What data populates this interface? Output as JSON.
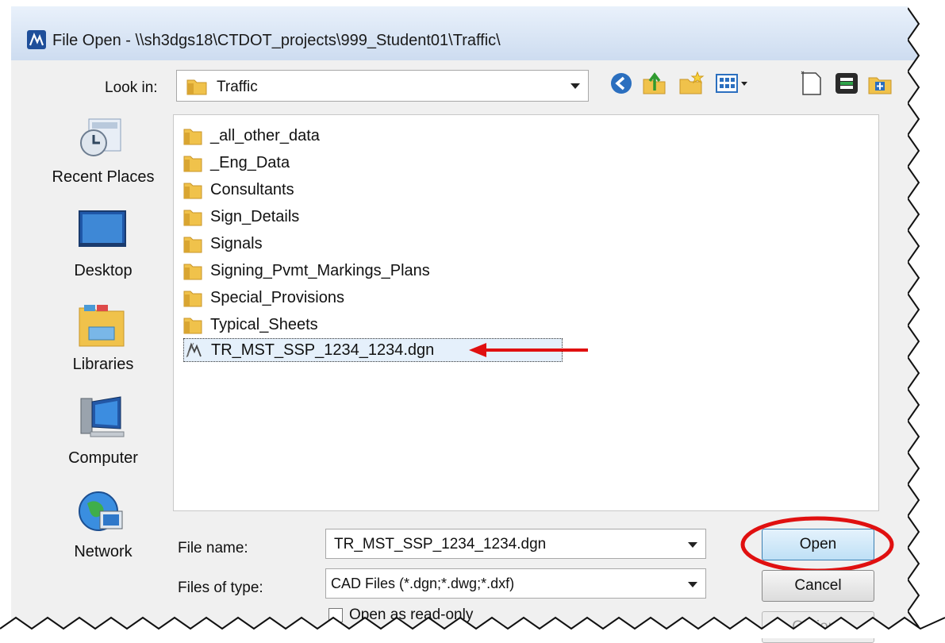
{
  "window": {
    "title": "File Open - \\\\sh3dgs18\\CTDOT_projects\\999_Student01\\Traffic\\"
  },
  "lookin": {
    "label": "Look in:",
    "value": "Traffic"
  },
  "toolbar": {
    "icons": [
      "back-icon",
      "up-folder-icon",
      "new-folder-icon",
      "view-menu-icon",
      "new-file-icon",
      "bentley-icon",
      "workset-icon"
    ]
  },
  "places": [
    {
      "label": "Recent Places",
      "icon": "recent-places-icon"
    },
    {
      "label": "Desktop",
      "icon": "desktop-icon"
    },
    {
      "label": "Libraries",
      "icon": "libraries-icon"
    },
    {
      "label": "Computer",
      "icon": "computer-icon"
    },
    {
      "label": "Network",
      "icon": "network-icon"
    }
  ],
  "files": [
    {
      "name": "_all_other_data",
      "type": "folder"
    },
    {
      "name": "_Eng_Data",
      "type": "folder"
    },
    {
      "name": "Consultants",
      "type": "folder"
    },
    {
      "name": "Sign_Details",
      "type": "folder"
    },
    {
      "name": "Signals",
      "type": "folder"
    },
    {
      "name": "Signing_Pvmt_Markings_Plans",
      "type": "folder"
    },
    {
      "name": "Special_Provisions",
      "type": "folder"
    },
    {
      "name": "Typical_Sheets",
      "type": "folder"
    },
    {
      "name": "TR_MST_SSP_1234_1234.dgn",
      "type": "dgn",
      "selected": true
    }
  ],
  "filename": {
    "label": "File name:",
    "value": "TR_MST_SSP_1234_1234.dgn"
  },
  "filetype": {
    "label": "Files of type:",
    "value": "CAD Files (*.dgn;*.dwg;*.dxf)"
  },
  "buttons": {
    "open": "Open",
    "cancel": "Cancel",
    "options": "Options"
  },
  "readonly": {
    "label": "Open as read-only"
  },
  "annotation_color": "#e01010",
  "folder_color": "#f0c24b"
}
